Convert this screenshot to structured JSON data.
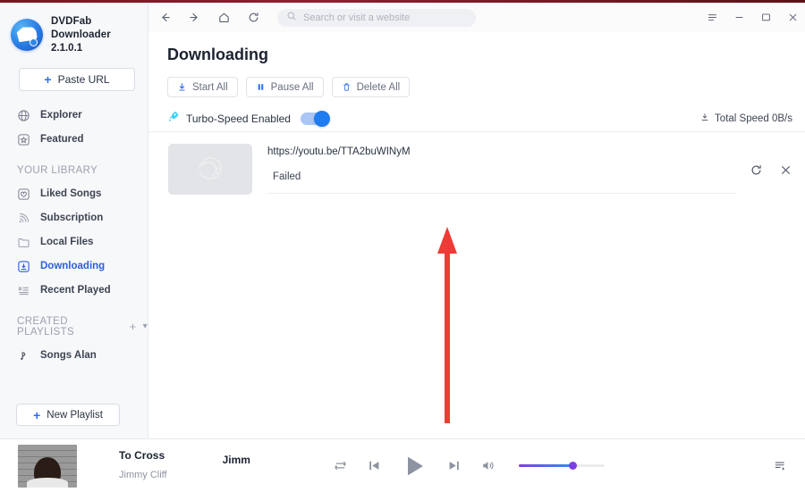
{
  "window": {
    "controls": [
      {
        "name": "menu-button",
        "glyph": "menu"
      },
      {
        "name": "minimize-button",
        "glyph": "minimize"
      },
      {
        "name": "maximize-button",
        "glyph": "maximize"
      },
      {
        "name": "close-button",
        "glyph": "close"
      }
    ]
  },
  "sidebar": {
    "brand": {
      "name": "DVDFab Downloader",
      "version": "2.1.0.1"
    },
    "paste_url_label": "Paste URL",
    "nav": [
      {
        "label": "Explorer",
        "icon": "globe-icon",
        "active": false
      },
      {
        "label": "Featured",
        "icon": "star-box-icon",
        "active": false
      }
    ],
    "library_label": "YOUR LIBRARY",
    "library": [
      {
        "label": "Liked Songs",
        "icon": "heart-box-icon",
        "active": false
      },
      {
        "label": "Subscription",
        "icon": "rss-icon",
        "active": false
      },
      {
        "label": "Local Files",
        "icon": "folder-icon",
        "active": false
      },
      {
        "label": "Downloading",
        "icon": "download-box-icon",
        "active": true
      },
      {
        "label": "Recent Played",
        "icon": "playlist-icon",
        "active": false
      }
    ],
    "playlists_label": "CREATED PLAYLISTS",
    "playlists_plus": "+",
    "playlists": [
      {
        "label": "Songs Alan",
        "icon": "music-note-icon"
      }
    ],
    "new_playlist_label": "New Playlist"
  },
  "topbar": {
    "back": "back-arrow",
    "forward": "forward-arrow",
    "home": "home",
    "reload": "reload",
    "search_placeholder": "Search or visit a website",
    "search_value": ""
  },
  "main": {
    "title": "Downloading",
    "toolbar": [
      {
        "label": "Start All",
        "icon": "download-arrow-icon"
      },
      {
        "label": "Pause All",
        "icon": "pause-icon"
      },
      {
        "label": "Delete All",
        "icon": "trash-icon"
      }
    ],
    "turbo": {
      "label": "Turbo-Speed Enabled",
      "icon": "rocket-icon",
      "enabled": true
    },
    "total_speed": "Total Speed 0B/s",
    "downloads": [
      {
        "url": "https://youtu.be/TTA2buWINyM",
        "status": "Failed",
        "thumbnail": "broken-image-placeholder",
        "actions": [
          {
            "name": "retry-icon",
            "label": "Retry"
          },
          {
            "name": "close-icon",
            "label": "Remove"
          }
        ]
      }
    ],
    "annotation": {
      "type": "red-arrow",
      "points_to": "Failed"
    }
  },
  "player": {
    "track_title": "To Cross",
    "track_artist": "Jimmy Cliff",
    "alt_title": "Jimm",
    "controls": [
      {
        "name": "repeat-button",
        "icon": "repeat-icon"
      },
      {
        "name": "previous-button",
        "icon": "previous-icon"
      },
      {
        "name": "play-button",
        "icon": "play-icon"
      },
      {
        "name": "next-button",
        "icon": "next-icon"
      },
      {
        "name": "volume-button",
        "icon": "speaker-icon"
      }
    ],
    "volume_percent": 60,
    "queue_label": "queue-icon"
  },
  "colors": {
    "accent_blue": "#2b5fd9",
    "toggle_blue": "#1f7bf0",
    "annotation_red": "#ef3b35",
    "sidebar_bg": "#f7f8fa",
    "muted_text": "#9aa1ae"
  }
}
